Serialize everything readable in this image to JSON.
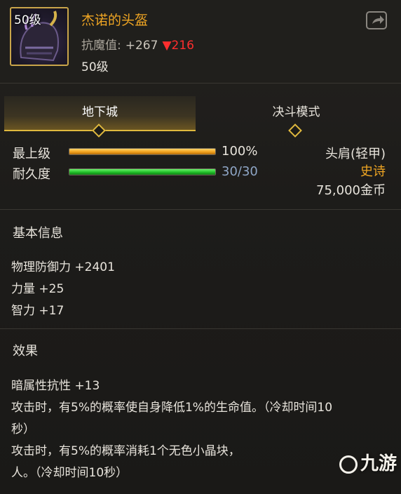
{
  "header": {
    "icon_level": "50级",
    "name": "杰诺的头盔",
    "stat_label": "抗魔值:",
    "stat_value": "+267",
    "stat_diff": "▼216",
    "level": "50级",
    "share_icon": "share-icon"
  },
  "tabs": [
    {
      "label": "地下城",
      "active": true
    },
    {
      "label": "决斗模式",
      "active": false
    }
  ],
  "bars": {
    "max_level_label": "最上级",
    "max_level_value": "100%",
    "max_level_fraction": 1.0,
    "durability_label": "耐久度",
    "durability_value": "30/30",
    "durability_fraction": 1.0
  },
  "item_info": {
    "slot": "头肩(轻甲)",
    "rarity": "史诗",
    "price": "75,000金币"
  },
  "colors": {
    "name": "#f0a623",
    "rarity": "#f0a623",
    "stat_diff": "#ff2e2e",
    "durability_text": "#8fa6c6",
    "accent": "#e0b93e"
  },
  "basic_info": {
    "title": "基本信息",
    "lines": [
      "物理防御力 +2401",
      "力量 +25",
      "智力 +17"
    ]
  },
  "effects": {
    "title": "效果",
    "lines": [
      "暗属性抗性 +13",
      "攻击时，有5%的概率使自身降低1%的生命值。（冷却时间10",
      "秒）",
      "攻击时，有5%的概率消耗1个无色小晶块，",
      "人。（冷却时间10秒）"
    ]
  },
  "watermark": "九游"
}
